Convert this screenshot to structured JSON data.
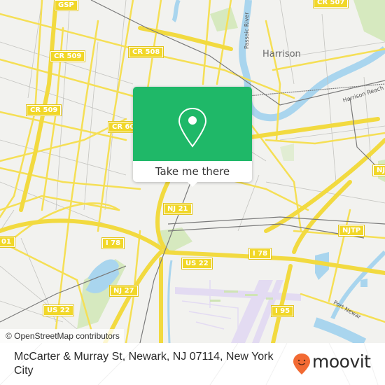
{
  "map": {
    "place_labels": [
      {
        "name": "Harrison"
      }
    ],
    "water_labels": [
      {
        "name": "Passaic River"
      },
      {
        "name": "Harrison Reach Rive"
      },
      {
        "name": "Port Newar"
      }
    ],
    "shields": [
      {
        "id": "gsp",
        "label": "GSP"
      },
      {
        "id": "cr509-a",
        "label": "CR 509"
      },
      {
        "id": "cr508",
        "label": "CR 508"
      },
      {
        "id": "cr507",
        "label": "CR 507"
      },
      {
        "id": "cr509-b",
        "label": "CR 509"
      },
      {
        "id": "cr60",
        "label": "CR 60"
      },
      {
        "id": "nj21",
        "label": "NJ 21"
      },
      {
        "id": "i78-left",
        "label": "I 78"
      },
      {
        "id": "i78-right",
        "label": "I 78"
      },
      {
        "id": "us22-left",
        "label": "US 22"
      },
      {
        "id": "us22-center",
        "label": "US 22"
      },
      {
        "id": "nj27",
        "label": "NJ 27"
      },
      {
        "id": "njtp-top",
        "label": "NJTP"
      },
      {
        "id": "njtp-mid",
        "label": "NJTP"
      },
      {
        "id": "i95",
        "label": "I 95"
      },
      {
        "id": "cr601",
        "label": "01"
      }
    ],
    "colors": {
      "land": "#f2f2ef",
      "road_major": "#f5df55",
      "road_minor": "#bdbdbd",
      "water": "#a9d5ee",
      "park": "#d6e9bf",
      "rail": "#777777",
      "airport": "#e3dbf2"
    }
  },
  "popup": {
    "icon": "map-pin-icon",
    "cta_label": "Take me there",
    "color": "#1fb868"
  },
  "attribution": "© OpenStreetMap contributors",
  "footer": {
    "address": "McCarter & Murray St, Newark, NJ 07114, New York City",
    "brand": "moovit",
    "brand_color": "#f26a33"
  }
}
